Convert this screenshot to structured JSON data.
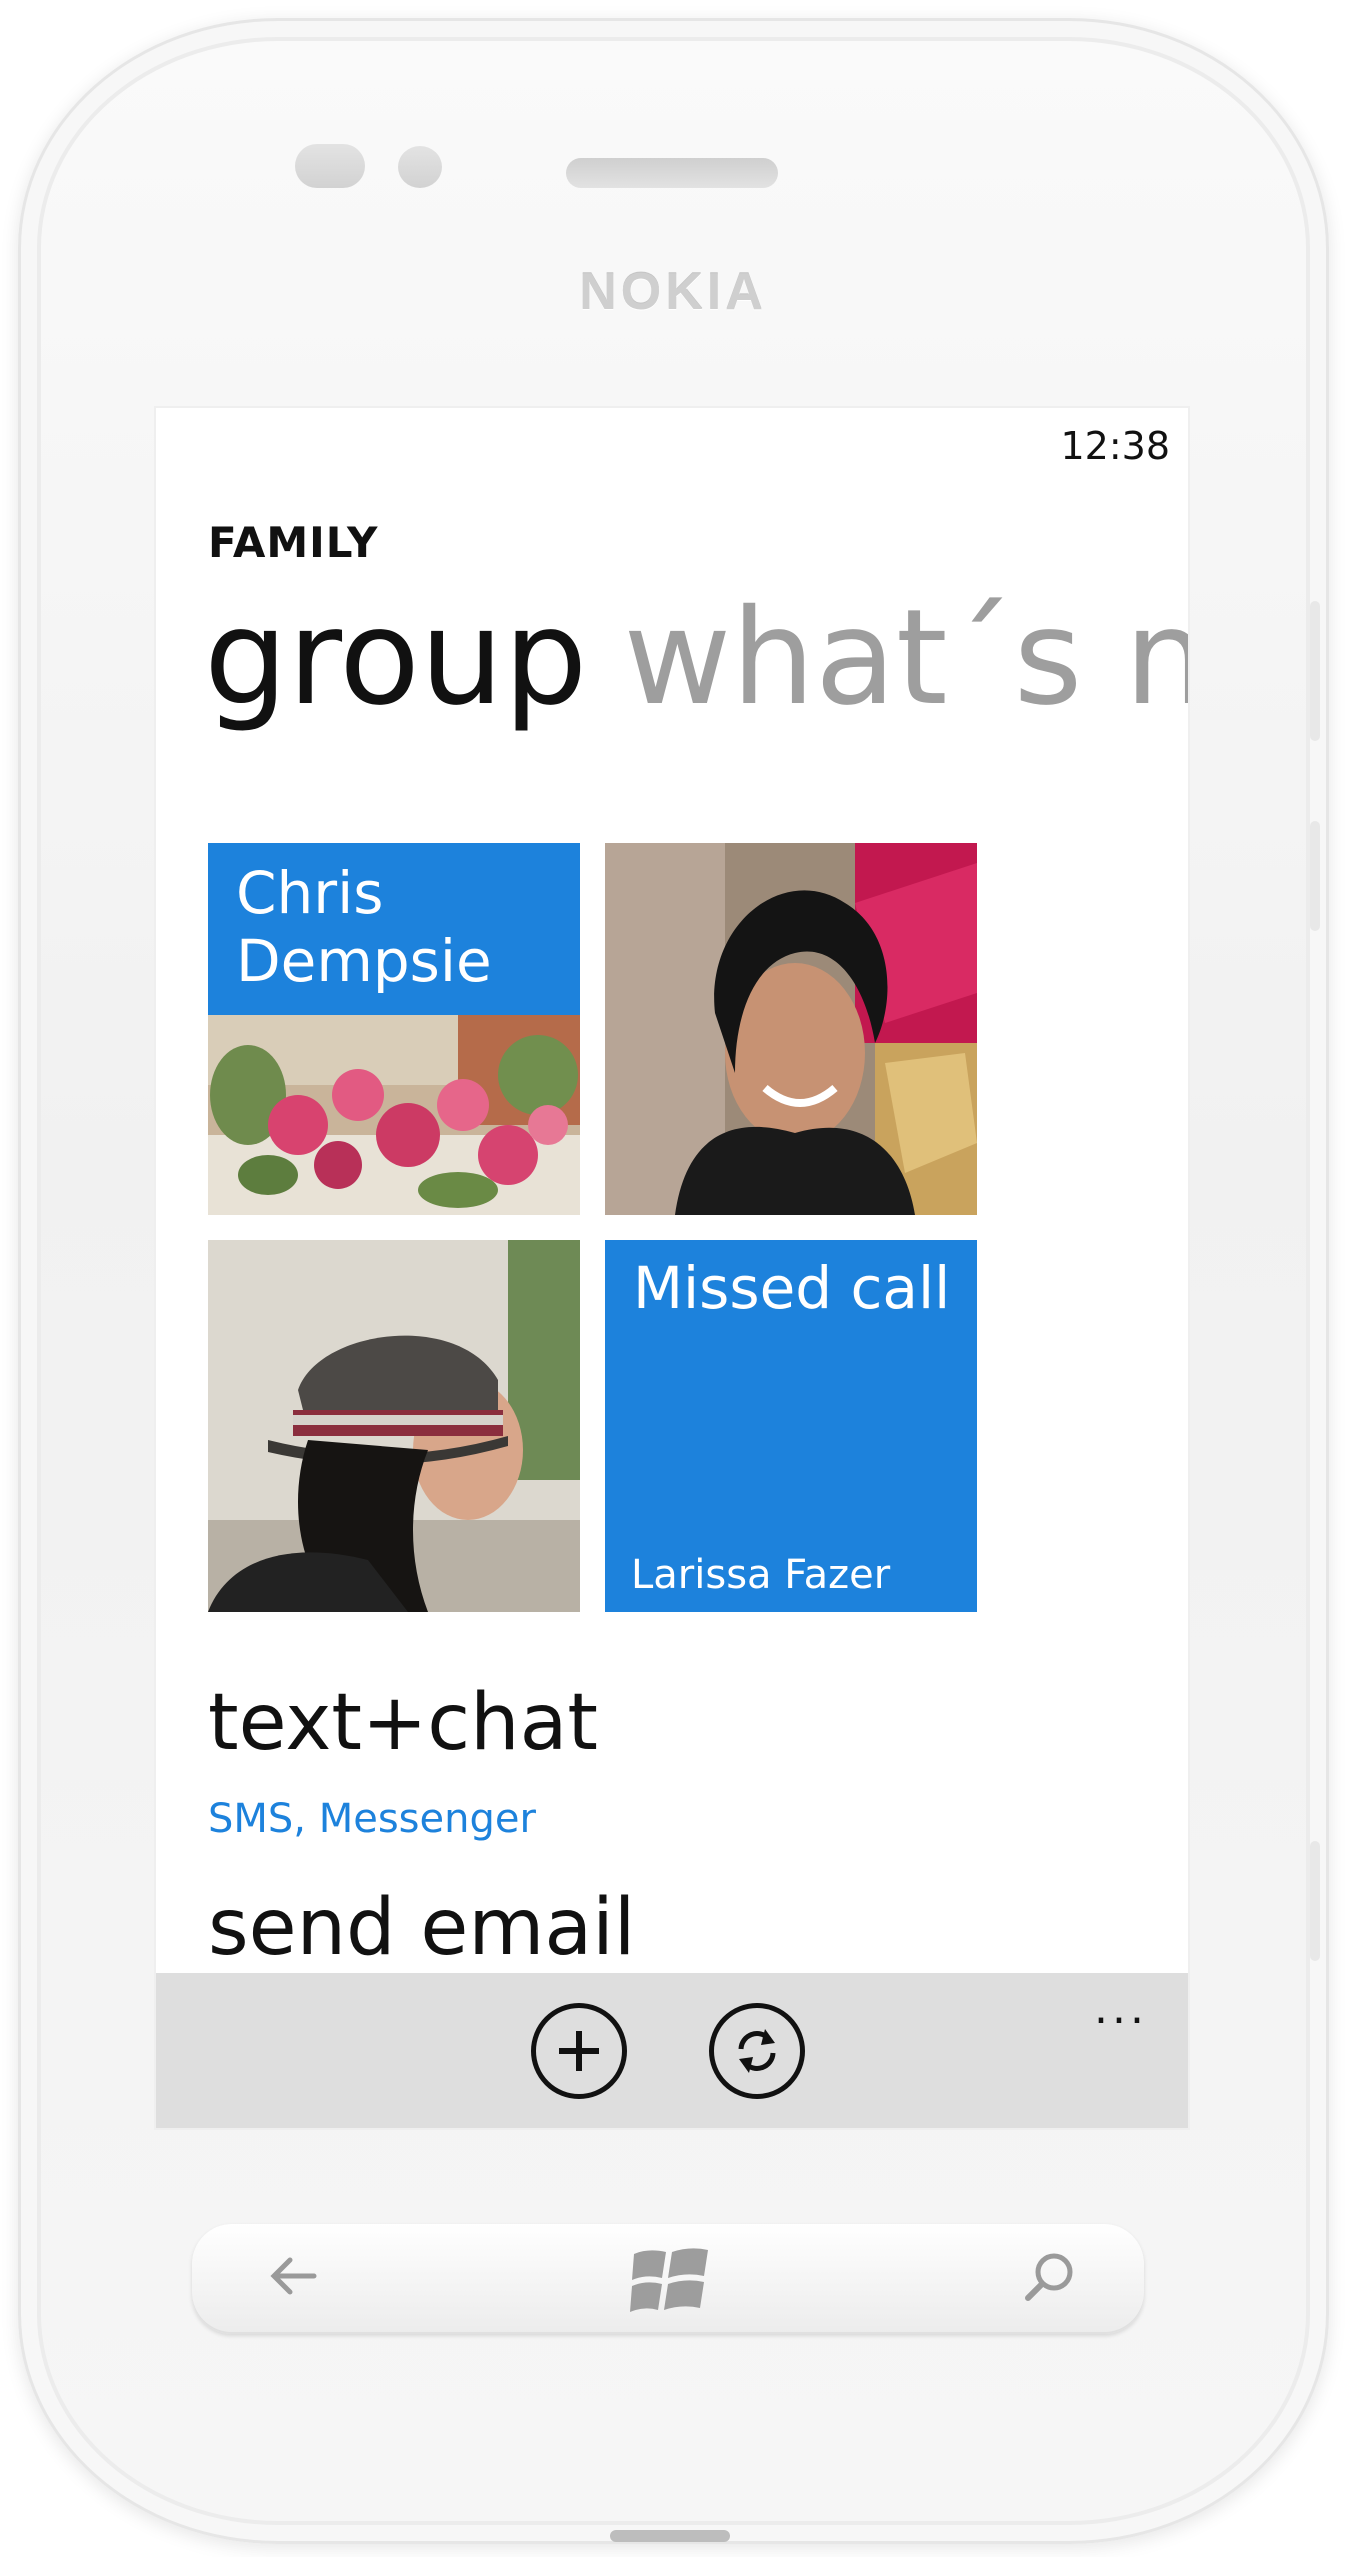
{
  "device": {
    "brand": "NOKIA"
  },
  "status_bar": {
    "time": "12:38"
  },
  "header": {
    "group_name": "FAMILY"
  },
  "pivot": {
    "active": "group",
    "next": "what´s ne"
  },
  "tiles": [
    {
      "title_line1": "Chris",
      "title_line2": "Dempsie",
      "image": "flowers-photo"
    },
    {
      "image": "smiling-woman-photo"
    },
    {
      "image": "woman-in-hat-photo"
    },
    {
      "title": "Missed call",
      "subtitle": "Larissa Fazer"
    }
  ],
  "menu": [
    {
      "title": "text+chat",
      "subtitle": "SMS, Messenger"
    },
    {
      "title": "send email"
    }
  ],
  "app_bar": {
    "buttons": [
      "add-icon",
      "sync-icon"
    ],
    "more": "..."
  },
  "hardware_keys": [
    "back-icon",
    "windows-start-icon",
    "search-icon"
  ],
  "colors": {
    "accent": "#1d82dc",
    "app_bar": "#dedede",
    "inactive_pivot": "#9e9e9e"
  }
}
